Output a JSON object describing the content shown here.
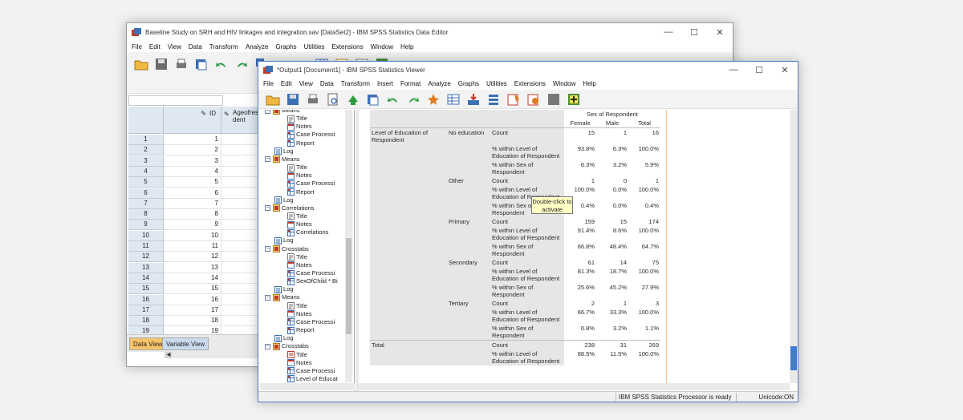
{
  "data_editor": {
    "title": "Baseline Study on SRH and HIV linkages and integration.sav [DataSet2] - IBM SPSS Statistics Data Editor",
    "menu": [
      "File",
      "Edit",
      "View",
      "Data",
      "Transform",
      "Analyze",
      "Graphs",
      "Utilities",
      "Extensions",
      "Window",
      "Help"
    ],
    "toolbar_icons": [
      "open-icon",
      "save-icon",
      "print-icon",
      "recall-dialog-icon",
      "undo-icon",
      "redo-icon",
      "goto-case-icon",
      "goto-variable-icon",
      "find-icon",
      "insert-cases-icon",
      "split-file-icon",
      "value-labels-icon",
      "use-sets-icon"
    ],
    "columns": {
      "id": "ID",
      "age": "Ageofres\ndent"
    },
    "rows": [
      "1",
      "2",
      "3",
      "4",
      "5",
      "6",
      "7",
      "8",
      "9",
      "10",
      "11",
      "12",
      "13",
      "14",
      "15",
      "16",
      "17",
      "18",
      "19",
      "20"
    ],
    "ids": [
      "1",
      "2",
      "3",
      "4",
      "5",
      "6",
      "7",
      "8",
      "9",
      "10",
      "11",
      "12",
      "13",
      "14",
      "15",
      "16",
      "17",
      "18",
      "19",
      "20"
    ],
    "tabs": {
      "data_view": "Data View",
      "variable_view": "Variable View"
    }
  },
  "viewer": {
    "title": "*Output1 [Document1] - IBM SPSS Statistics Viewer",
    "menu": [
      "File",
      "Edit",
      "View",
      "Data",
      "Transform",
      "Insert",
      "Format",
      "Analyze",
      "Graphs",
      "Utilities",
      "Extensions",
      "Window",
      "Help"
    ],
    "toolbar_icons": [
      "open-icon",
      "save-icon",
      "print-icon",
      "print-preview-icon",
      "export-icon",
      "recall-dialog-icon",
      "undo-icon",
      "redo-icon",
      "goto-data-icon",
      "goto-case-icon",
      "goto-variable-icon",
      "variables-icon",
      "designate-window-icon",
      "collapse-icon",
      "expand-icon",
      "show-icon",
      "hide-icon",
      "insert-heading-icon",
      "insert-title-icon"
    ],
    "outline": [
      {
        "level": 1,
        "text": "Means",
        "type": "proc"
      },
      {
        "level": 2,
        "text": "Title",
        "type": "title"
      },
      {
        "level": 2,
        "text": "Notes",
        "type": "notes"
      },
      {
        "level": 2,
        "text": "Case Processi",
        "type": "table"
      },
      {
        "level": 2,
        "text": "Report",
        "type": "table"
      },
      {
        "level": 1,
        "text": "Log",
        "type": "log"
      },
      {
        "level": 1,
        "text": "Means",
        "type": "proc"
      },
      {
        "level": 2,
        "text": "Title",
        "type": "title"
      },
      {
        "level": 2,
        "text": "Notes",
        "type": "notes"
      },
      {
        "level": 2,
        "text": "Case Processi",
        "type": "table"
      },
      {
        "level": 2,
        "text": "Report",
        "type": "table"
      },
      {
        "level": 1,
        "text": "Log",
        "type": "log"
      },
      {
        "level": 1,
        "text": "Correlations",
        "type": "proc"
      },
      {
        "level": 2,
        "text": "Title",
        "type": "title"
      },
      {
        "level": 2,
        "text": "Notes",
        "type": "notes"
      },
      {
        "level": 2,
        "text": "Correlations",
        "type": "table"
      },
      {
        "level": 1,
        "text": "Log",
        "type": "log"
      },
      {
        "level": 1,
        "text": "Crosstabs",
        "type": "proc"
      },
      {
        "level": 2,
        "text": "Title",
        "type": "title"
      },
      {
        "level": 2,
        "text": "Notes",
        "type": "notes"
      },
      {
        "level": 2,
        "text": "Case Processi",
        "type": "table"
      },
      {
        "level": 2,
        "text": "SexOfChild * Bi",
        "type": "table"
      },
      {
        "level": 1,
        "text": "Log",
        "type": "log"
      },
      {
        "level": 1,
        "text": "Means",
        "type": "proc"
      },
      {
        "level": 2,
        "text": "Title",
        "type": "title"
      },
      {
        "level": 2,
        "text": "Notes",
        "type": "notes"
      },
      {
        "level": 2,
        "text": "Case Processi",
        "type": "table"
      },
      {
        "level": 2,
        "text": "Report",
        "type": "table"
      },
      {
        "level": 1,
        "text": "Log",
        "type": "log"
      },
      {
        "level": 1,
        "text": "Crosstabs",
        "type": "proc"
      },
      {
        "level": 2,
        "text": "Title",
        "type": "title-active"
      },
      {
        "level": 2,
        "text": "Notes",
        "type": "notes"
      },
      {
        "level": 2,
        "text": "Case Processi",
        "type": "table"
      },
      {
        "level": 2,
        "text": "Level of Educat",
        "type": "table"
      }
    ],
    "crosstab": {
      "header": "Sex of Respondent",
      "columns": [
        "Female",
        "Male",
        "Total"
      ],
      "row_variable": "Level of Education of Respondent",
      "groups": [
        {
          "name": "No education",
          "rows": [
            {
              "stat": "Count",
              "values": [
                "15",
                "1",
                "16"
              ]
            },
            {
              "stat": "% within Level of Education of Respondent",
              "values": [
                "93.8%",
                "6.3%",
                "100.0%"
              ]
            },
            {
              "stat": "% within Sex of Respondent",
              "values": [
                "6.3%",
                "3.2%",
                "5.9%"
              ]
            }
          ]
        },
        {
          "name": "Other",
          "rows": [
            {
              "stat": "Count",
              "values": [
                "1",
                "0",
                "1"
              ]
            },
            {
              "stat": "% within Level of Education of Respondent",
              "values": [
                "100.0%",
                "0.0%",
                "100.0%"
              ]
            },
            {
              "stat": "% within Sex of Respondent",
              "values": [
                "0.4%",
                "0.0%",
                "0.4%"
              ]
            }
          ]
        },
        {
          "name": "Primary",
          "rows": [
            {
              "stat": "Count",
              "values": [
                "159",
                "15",
                "174"
              ]
            },
            {
              "stat": "% within Level of Education of Respondent",
              "values": [
                "91.4%",
                "8.6%",
                "100.0%"
              ]
            },
            {
              "stat": "% within Sex of Respondent",
              "values": [
                "66.8%",
                "48.4%",
                "64.7%"
              ]
            }
          ]
        },
        {
          "name": "Secondary",
          "rows": [
            {
              "stat": "Count",
              "values": [
                "61",
                "14",
                "75"
              ]
            },
            {
              "stat": "% within Level of Education of Respondent",
              "values": [
                "81.3%",
                "18.7%",
                "100.0%"
              ]
            },
            {
              "stat": "% within Sex of Respondent",
              "values": [
                "25.6%",
                "45.2%",
                "27.9%"
              ]
            }
          ]
        },
        {
          "name": "Tertiary",
          "rows": [
            {
              "stat": "Count",
              "values": [
                "2",
                "1",
                "3"
              ]
            },
            {
              "stat": "% within Level of Education of Respondent",
              "values": [
                "66.7%",
                "33.3%",
                "100.0%"
              ]
            },
            {
              "stat": "% within Sex of Respondent",
              "values": [
                "0.8%",
                "3.2%",
                "1.1%"
              ]
            }
          ]
        }
      ],
      "total": {
        "name": "Total",
        "rows": [
          {
            "stat": "Count",
            "values": [
              "238",
              "31",
              "269"
            ]
          },
          {
            "stat": "% within Level of Education of Respondent",
            "values": [
              "88.5%",
              "11.5%",
              "100.0%"
            ]
          }
        ]
      },
      "tooltip": "Double-click to activate"
    },
    "status": {
      "processor": "IBM SPSS Statistics Processor is ready",
      "unicode": "Unicode:ON"
    }
  },
  "colors": {
    "accent": "#4f80c9",
    "header_gray": "#e6e6e6",
    "grid_header": "#dfe7f1",
    "tooltip": "#ffffc6",
    "active_tab": "#f7c46a"
  }
}
